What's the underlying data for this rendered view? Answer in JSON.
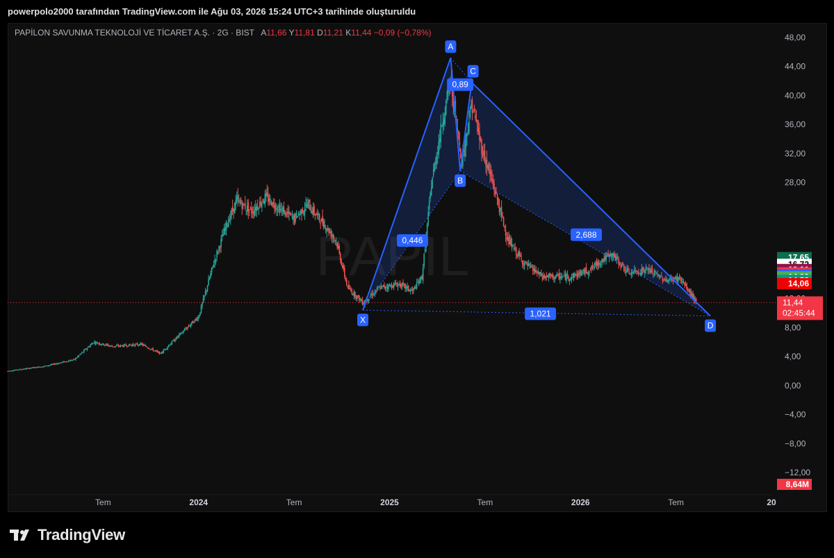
{
  "header": {
    "text": "powerpolo2000 tarafından TradingView.com ile Ağu 03, 2026 15:24 UTC+3 tarihinde oluşturuldu"
  },
  "legend": {
    "name": "PAPİLON SAVUNMA TEKNOLOJİ VE TİCARET A.Ş. · 2G · BIST",
    "a_k": "A",
    "a_v": "11,66",
    "y_k": "Y",
    "y_v": "11,81",
    "d_k": "D",
    "d_v": "11,21",
    "kk": "K",
    "k_v": "11,44",
    "chg": "−0,09 (−0,78%)"
  },
  "watermark": "PAPIL",
  "brand": "TradingView",
  "colors": {
    "up": "#26a69a",
    "down": "#ef5350",
    "pattern": "#2962ff",
    "label_bg": "#2962ff"
  },
  "chart_data": {
    "type": "candlestick",
    "ylim": [
      -14,
      50
    ],
    "y_ticks": [
      "48,00",
      "44,00",
      "40,00",
      "36,00",
      "32,00",
      "28,00",
      "12,00",
      "8,00",
      "4,00",
      "0,00",
      "−4,00",
      "−8,00",
      "−12,00"
    ],
    "x_ticks": [
      {
        "label": "Tem",
        "date": "2023.50",
        "bold": false
      },
      {
        "label": "2024",
        "date": "2024.00",
        "bold": true
      },
      {
        "label": "Tem",
        "date": "2024.50",
        "bold": false
      },
      {
        "label": "2025",
        "date": "2025.00",
        "bold": true
      },
      {
        "label": "Tem",
        "date": "2025.50",
        "bold": false
      },
      {
        "label": "2026",
        "date": "2026.00",
        "bold": true
      },
      {
        "label": "Tem",
        "date": "2026.50",
        "bold": false
      },
      {
        "label": "20",
        "date": "2027.00",
        "bold": true
      }
    ],
    "last_price": 11.44,
    "price_tags": [
      {
        "label": "17,65",
        "value": 17.65,
        "color": "#0b6e4f",
        "text": "#ffffff"
      },
      {
        "label": "16,72",
        "value": 16.72,
        "color": "#ffffff",
        "text": "#000000"
      },
      {
        "label": "16,01",
        "value": 16.01,
        "color": "#8e1548",
        "text": "#ffffff"
      },
      {
        "label": "15,54",
        "value": 15.54,
        "color": "#f23645",
        "text": "#ffffff"
      },
      {
        "label": "15,30",
        "value": 15.3,
        "color": "#2962ff",
        "text": "#ffffff"
      },
      {
        "label": "14,99",
        "value": 14.99,
        "color": "#4caf50",
        "text": "#ffffff"
      },
      {
        "label": "14,52",
        "value": 14.52,
        "color": "#089981",
        "text": "#ffffff"
      },
      {
        "label": "14,06",
        "value": 14.06,
        "color": "#f00000",
        "text": "#ffffff"
      }
    ],
    "last_tag": {
      "price": "11,44",
      "countdown": "02:45:44"
    },
    "volume_tag": "8,64M",
    "pattern": {
      "points": [
        {
          "name": "X",
          "t": 2024.86,
          "v": 10.4
        },
        {
          "name": "A",
          "t": 2025.32,
          "v": 45.2
        },
        {
          "name": "B",
          "t": 2025.37,
          "v": 29.6
        },
        {
          "name": "C",
          "t": 2025.43,
          "v": 41.8
        },
        {
          "name": "D",
          "t": 2026.68,
          "v": 9.6
        }
      ],
      "ratios": [
        {
          "label": "0,446",
          "t": 2025.12,
          "v": 20.0
        },
        {
          "label": "0,89",
          "t": 2025.37,
          "v": 41.5
        },
        {
          "label": "2,688",
          "t": 2026.03,
          "v": 20.8
        },
        {
          "label": "1,021",
          "t": 2025.79,
          "v": 9.9
        }
      ]
    },
    "anchors": [
      [
        2023.0,
        2.0
      ],
      [
        2023.2,
        2.7
      ],
      [
        2023.35,
        3.6
      ],
      [
        2023.45,
        6.0
      ],
      [
        2023.55,
        5.4
      ],
      [
        2023.7,
        5.7
      ],
      [
        2023.8,
        4.4
      ],
      [
        2023.9,
        7.0
      ],
      [
        2024.0,
        9.5
      ],
      [
        2024.08,
        17.0
      ],
      [
        2024.15,
        22.5
      ],
      [
        2024.2,
        25.5
      ],
      [
        2024.28,
        24.0
      ],
      [
        2024.35,
        26.0
      ],
      [
        2024.42,
        24.5
      ],
      [
        2024.5,
        23.0
      ],
      [
        2024.57,
        25.0
      ],
      [
        2024.65,
        22.5
      ],
      [
        2024.72,
        20.0
      ],
      [
        2024.78,
        13.5
      ],
      [
        2024.86,
        11.5
      ],
      [
        2024.95,
        13.5
      ],
      [
        2025.05,
        14.0
      ],
      [
        2025.12,
        13.0
      ],
      [
        2025.17,
        15.0
      ],
      [
        2025.22,
        28.0
      ],
      [
        2025.28,
        37.0
      ],
      [
        2025.32,
        42.0
      ],
      [
        2025.35,
        36.0
      ],
      [
        2025.38,
        31.0
      ],
      [
        2025.43,
        39.0
      ],
      [
        2025.48,
        33.0
      ],
      [
        2025.55,
        27.0
      ],
      [
        2025.62,
        20.0
      ],
      [
        2025.7,
        17.0
      ],
      [
        2025.8,
        15.0
      ],
      [
        2025.95,
        15.0
      ],
      [
        2026.05,
        16.0
      ],
      [
        2026.12,
        17.5
      ],
      [
        2026.17,
        18.0
      ],
      [
        2026.25,
        15.5
      ],
      [
        2026.35,
        16.0
      ],
      [
        2026.45,
        14.5
      ],
      [
        2026.52,
        14.8
      ],
      [
        2026.58,
        12.5
      ],
      [
        2026.61,
        11.44
      ]
    ]
  }
}
